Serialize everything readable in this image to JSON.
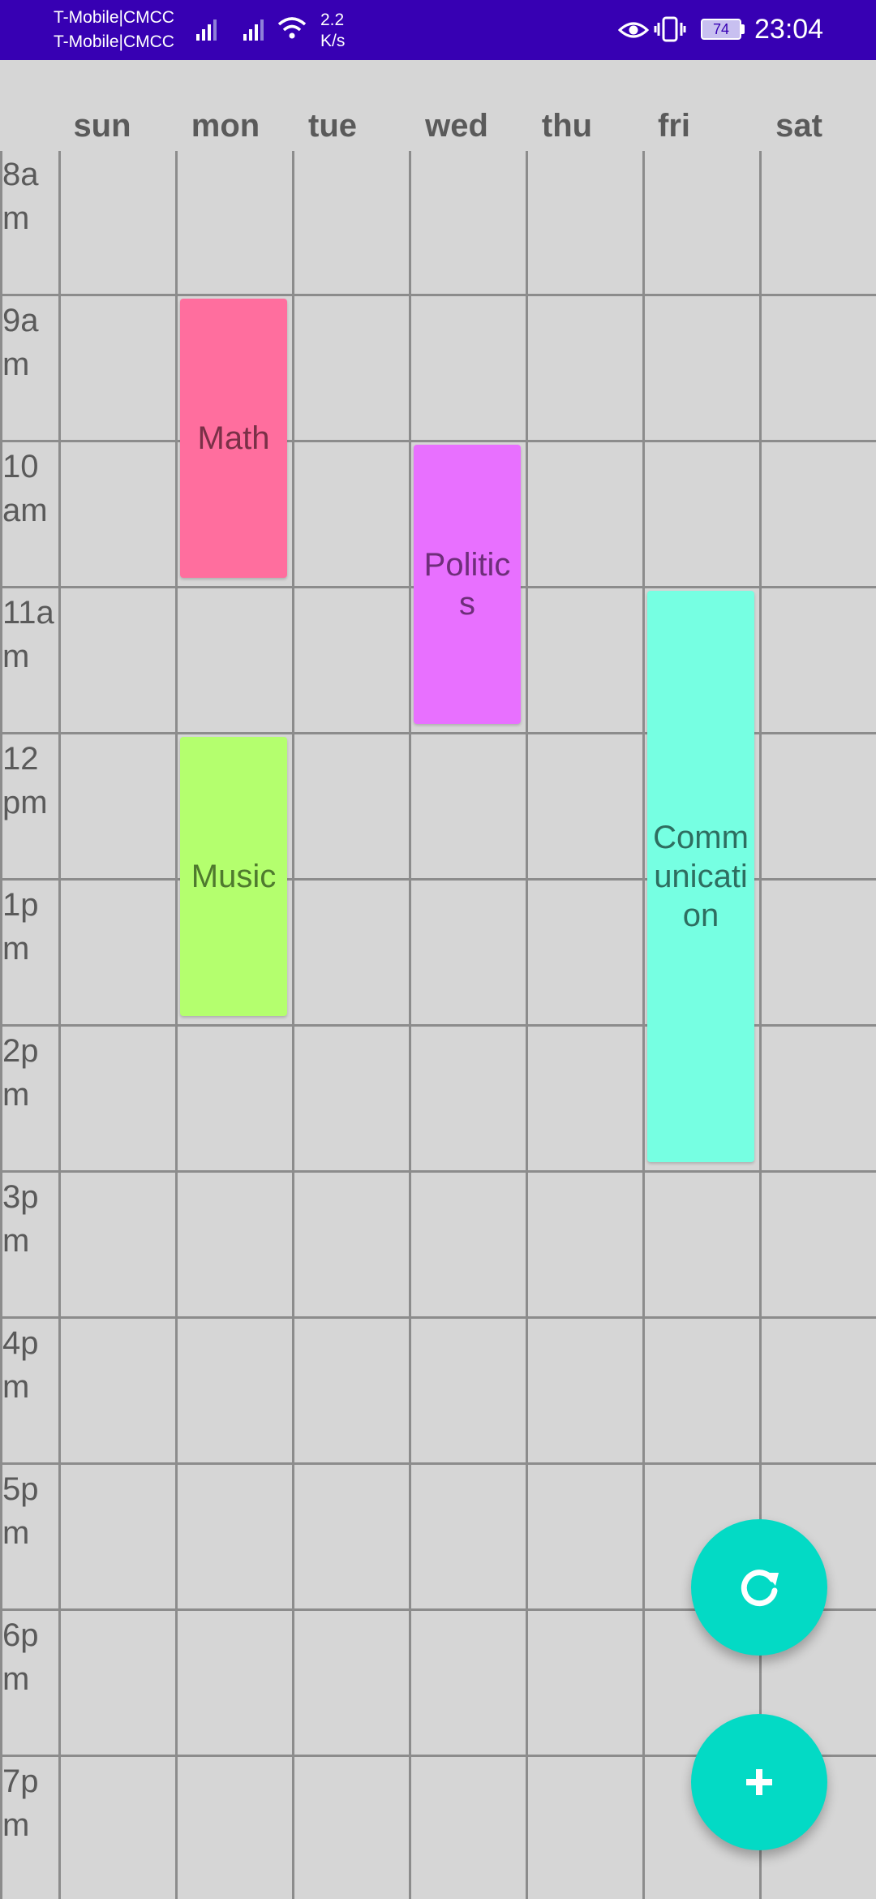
{
  "status_bar": {
    "carrier_1": "T-Mobile|CMCC",
    "carrier_2": "T-Mobile|CMCC",
    "network_speed_value": "2.2",
    "network_speed_unit": "K/s",
    "battery": "74",
    "time": "23:04",
    "icons": [
      "signal-icon",
      "signal-icon",
      "wifi-icon",
      "eye-icon",
      "vibrate-icon",
      "battery-icon"
    ]
  },
  "days": [
    "sun",
    "mon",
    "tue",
    "wed",
    "thu",
    "fri",
    "sat"
  ],
  "times": [
    "8am",
    "9am",
    "10am",
    "11am",
    "12pm",
    "1pm",
    "2pm",
    "3pm",
    "4pm",
    "5pm",
    "6pm",
    "7pm"
  ],
  "events": [
    {
      "name": "Math",
      "day": "mon",
      "start": "9am",
      "end": "11am",
      "color": "#ff6e9e",
      "text_color": "#7a3047"
    },
    {
      "name": "Politics",
      "day": "wed",
      "start": "10am",
      "end": "12pm",
      "color": "#e870ff",
      "text_color": "#6e2e7a"
    },
    {
      "name": "Communication",
      "day": "fri",
      "start": "11am",
      "end": "3pm",
      "color": "#76ffe2",
      "text_color": "#2e6e60"
    },
    {
      "name": "Music",
      "day": "mon",
      "start": "12pm",
      "end": "2pm",
      "color": "#b4ff6e",
      "text_color": "#4f7a2e"
    }
  ],
  "actions": {
    "refresh_icon": "refresh-icon",
    "add_icon": "plus-icon",
    "accent_color": "#03dac5"
  },
  "theme": {
    "status_bar_color": "#3700b3",
    "background_color": "#d6d6d6",
    "grid_color": "#8c8c8c"
  }
}
